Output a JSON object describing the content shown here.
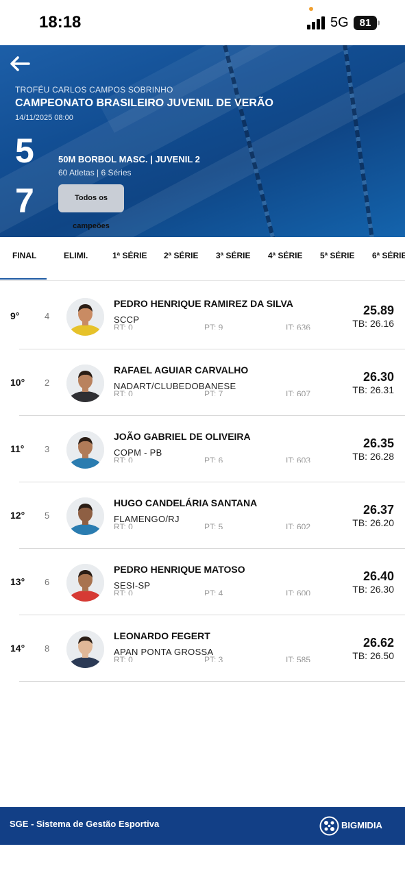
{
  "status_bar": {
    "time": "18:18",
    "network": "5G",
    "battery": "81"
  },
  "header": {
    "trophy": "TROFÉU CARLOS CAMPOS SOBRINHO",
    "title": "CAMPEONATO BRASILEIRO JUVENIL DE VERÃO",
    "date": "14/11/2025 08:00",
    "number_top": "5",
    "number_bottom": "7",
    "event_name": "50M BORBOL MASC. | JUVENIL 2",
    "event_info": "60 Atletas | 6 Séries",
    "champions_button": "Todos os campeões"
  },
  "tabs": [
    {
      "label": "FINAL",
      "active": true
    },
    {
      "label": "ELIMI."
    },
    {
      "label": "1ª SÉRIE"
    },
    {
      "label": "2ª SÉRIE"
    },
    {
      "label": "3ª SÉRIE"
    },
    {
      "label": "4ª SÉRIE"
    },
    {
      "label": "5ª SÉRIE"
    },
    {
      "label": "6ª SÉRIE"
    }
  ],
  "results": [
    {
      "place": "9°",
      "lane": "4",
      "name": "PEDRO HENRIQUE RAMIREZ DA SILVA",
      "club": "SCCP",
      "rt": "RT: 0",
      "pt": "PT: 9",
      "it": "IT: 636",
      "time": "25.89",
      "tb": "TB: 26.16",
      "skin": "#c98b63",
      "shirt": "#e6c22a"
    },
    {
      "place": "10°",
      "lane": "2",
      "name": "RAFAEL AGUIAR CARVALHO",
      "club": "NADART/CLUBEDOBANESE",
      "rt": "RT: 0",
      "pt": "PT: 7",
      "it": "IT: 607",
      "time": "26.30",
      "tb": "TB: 26.31",
      "skin": "#b9825e",
      "shirt": "#2f2f33"
    },
    {
      "place": "11°",
      "lane": "3",
      "name": "JOÃO GABRIEL DE OLIVEIRA",
      "club": "COPM - PB",
      "rt": "RT: 0",
      "pt": "PT: 6",
      "it": "IT: 603",
      "time": "26.35",
      "tb": "TB: 26.28",
      "skin": "#b07b58",
      "shirt": "#2a7cb0"
    },
    {
      "place": "12°",
      "lane": "5",
      "name": "HUGO CANDELÁRIA SANTANA",
      "club": "FLAMENGO/RJ",
      "rt": "RT: 0",
      "pt": "PT: 5",
      "it": "IT: 602",
      "time": "26.37",
      "tb": "TB: 26.20",
      "skin": "#8e5f43",
      "shirt": "#2a7cb0"
    },
    {
      "place": "13°",
      "lane": "6",
      "name": "PEDRO HENRIQUE MATOSO",
      "club": "SESI-SP",
      "rt": "RT: 0",
      "pt": "PT: 4",
      "it": "IT: 600",
      "time": "26.40",
      "tb": "TB: 26.30",
      "skin": "#a8734f",
      "shirt": "#d63a34"
    },
    {
      "place": "14°",
      "lane": "8",
      "name": "LEONARDO FEGERT",
      "club": "APAN PONTA GROSSA",
      "rt": "RT: 0",
      "pt": "PT: 3",
      "it": "IT: 585",
      "time": "26.62",
      "tb": "TB: 26.50",
      "skin": "#e0b898",
      "shirt": "#2b3a55"
    }
  ],
  "footer": {
    "text": "SGE - Sistema de Gestão Esportiva",
    "brand": "BIGMIDIA"
  },
  "icons": {
    "back": "arrow-left-icon",
    "signal": "signal-icon",
    "battery": "battery-icon",
    "logo": "bigmidia-logo-icon"
  }
}
